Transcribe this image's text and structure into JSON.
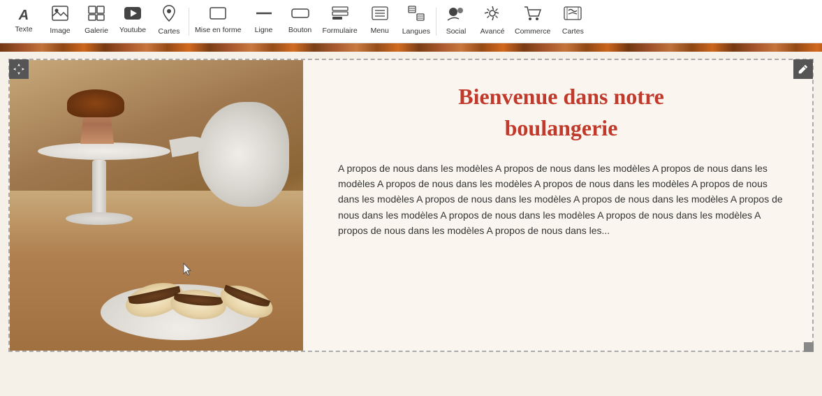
{
  "toolbar": {
    "items": [
      {
        "id": "texte",
        "label": "Texte",
        "icon": "A"
      },
      {
        "id": "image",
        "label": "Image",
        "icon": "🖼"
      },
      {
        "id": "galerie",
        "label": "Galerie",
        "icon": "⊞"
      },
      {
        "id": "youtube",
        "label": "Youtube",
        "icon": "▶"
      },
      {
        "id": "cartes1",
        "label": "Cartes",
        "icon": "📍"
      },
      {
        "id": "mise-en-forme",
        "label": "Mise en forme",
        "icon": "▭"
      },
      {
        "id": "ligne",
        "label": "Ligne",
        "icon": "—"
      },
      {
        "id": "bouton",
        "label": "Bouton",
        "icon": "⬚"
      },
      {
        "id": "formulaire",
        "label": "Formulaire",
        "icon": "☰"
      },
      {
        "id": "menu",
        "label": "Menu",
        "icon": "⊟"
      },
      {
        "id": "langues",
        "label": "Langues",
        "icon": "⊕"
      },
      {
        "id": "social",
        "label": "Social",
        "icon": "👥"
      },
      {
        "id": "avance",
        "label": "Avancé",
        "icon": "⚙"
      },
      {
        "id": "commerce",
        "label": "Commerce",
        "icon": "🛒"
      },
      {
        "id": "cartes2",
        "label": "Cartes",
        "icon": "🗺"
      }
    ]
  },
  "content": {
    "title_line1": "Bienvenue dans notre",
    "title_line2": "boulangerie",
    "description": "A propos de nous dans les modèles A propos de nous dans les modèles A propos de nous dans les modèles A propos de nous dans les modèles A propos de nous dans les modèles A propos de nous dans les modèles A propos de nous dans les modèles A propos de nous dans les modèles A propos de nous dans les modèles A propos de nous dans les modèles A propos de nous dans les modèles A propos de nous dans les modèles A propos de nous dans les..."
  },
  "handles": {
    "move": "⊹",
    "edit": "✎"
  }
}
